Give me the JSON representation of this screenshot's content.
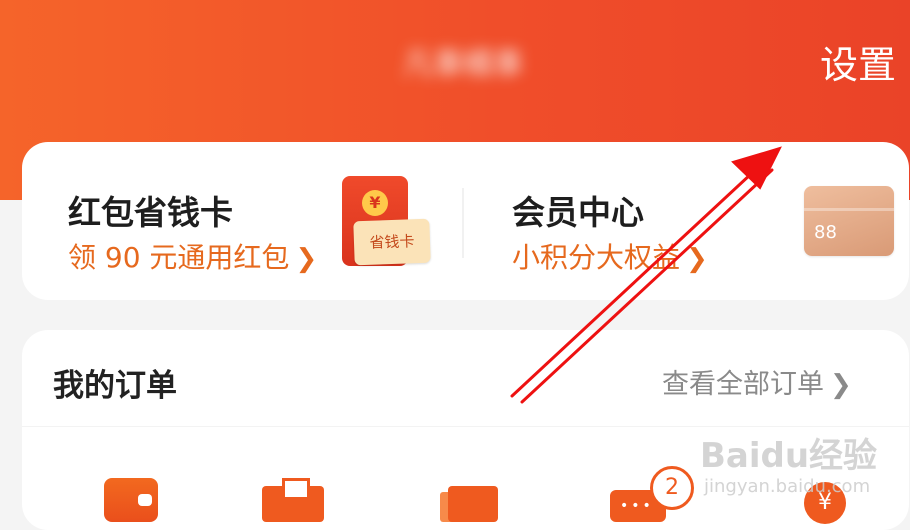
{
  "header": {
    "username": "凡事橘事",
    "settings_label": "设置"
  },
  "benefits": [
    {
      "title": "红包省钱卡",
      "subtitle": "领 90 元通用红包",
      "icon_text": "省钱卡",
      "icon_coin": "¥"
    },
    {
      "title": "会员中心",
      "subtitle": "小积分大权益",
      "icon_text": "88"
    }
  ],
  "orders": {
    "title": "我的订单",
    "view_all": "查看全部订单",
    "review_badge": "2",
    "refund_symbol": "¥"
  },
  "watermark": {
    "main": "Baidu经验",
    "sub": "jingyan.baidu.com"
  },
  "colors": {
    "header_start": "#f5642a",
    "header_end": "#ea4328",
    "accent_orange": "#e6691e",
    "annotation_arrow": "#ee1111"
  }
}
